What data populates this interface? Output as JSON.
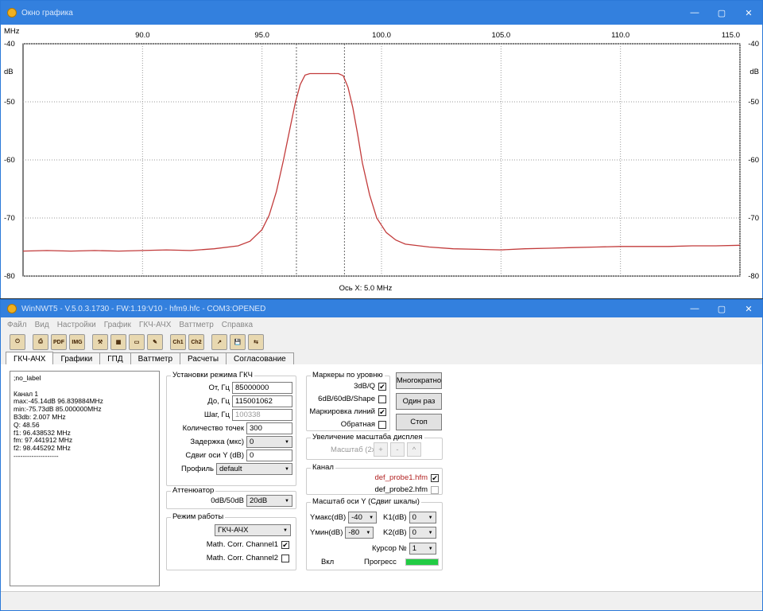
{
  "graph_window": {
    "title": "Окно графика",
    "controls": {
      "minimize": "—",
      "maximize": "▢",
      "close": "✕"
    },
    "x_unit": "MHz",
    "y_unit": "dB",
    "x_axis_label": "Ось X: 5.0 MHz"
  },
  "chart_data": {
    "type": "line",
    "xlim": [
      85.0,
      115.0
    ],
    "ylim": [
      -80,
      -40
    ],
    "x_ticks": [
      "90.0",
      "95.0",
      "100.0",
      "105.0",
      "110.0",
      "115.0"
    ],
    "x_tick_values": [
      90,
      95,
      100,
      105,
      110,
      115
    ],
    "y_ticks": [
      "-40",
      "-50",
      "-60",
      "-70",
      "-80"
    ],
    "y_tick_values": [
      -40,
      -50,
      -60,
      -70,
      -80
    ],
    "grid": true,
    "marker_lines_x": [
      96.44,
      98.45
    ],
    "color": "#c23b3b",
    "series": [
      {
        "x": [
          85.0,
          86.0,
          87.0,
          88.0,
          89.0,
          90.0,
          91.0,
          92.0,
          93.0,
          94.0,
          94.5,
          95.0,
          95.3,
          95.6,
          95.9,
          96.2,
          96.4,
          96.6,
          96.8,
          97.0,
          97.2,
          97.4,
          97.6,
          97.8,
          98.0,
          98.2,
          98.4,
          98.6,
          98.8,
          99.0,
          99.2,
          99.5,
          99.8,
          100.2,
          100.6,
          101.0,
          102.0,
          103.0,
          104.0,
          105.0,
          106.0,
          107.0,
          108.0,
          109.0,
          110.0,
          111.0,
          112.0,
          113.0,
          114.0,
          115.0
        ],
        "y": [
          -75.7,
          -75.6,
          -75.7,
          -75.6,
          -75.7,
          -75.6,
          -75.5,
          -75.6,
          -75.3,
          -74.8,
          -74.0,
          -72.0,
          -69.5,
          -65.5,
          -60.0,
          -54.0,
          -50.0,
          -47.0,
          -45.4,
          -45.14,
          -45.14,
          -45.14,
          -45.14,
          -45.14,
          -45.14,
          -45.14,
          -45.5,
          -47.5,
          -51.0,
          -55.5,
          -60.5,
          -66.0,
          -70.0,
          -72.5,
          -73.8,
          -74.5,
          -75.0,
          -75.3,
          -75.4,
          -75.5,
          -75.3,
          -75.2,
          -75.1,
          -75.0,
          -74.9,
          -74.9,
          -74.9,
          -74.8,
          -74.8,
          -74.7
        ]
      }
    ]
  },
  "main_window": {
    "title": "WinNWT5 - V.5.0.3.1730 - FW:1.19:V10 - hfm9.hfc - COM3:OPENED",
    "menu": [
      "Файл",
      "Вид",
      "Настройки",
      "График",
      "ГКЧ-АЧХ",
      "Ваттметр",
      "Справка"
    ],
    "toolbar": [
      {
        "name": "power-icon",
        "glyph": "⏻"
      },
      {
        "name": "print-icon",
        "glyph": "⎙"
      },
      {
        "name": "export-pdf-icon",
        "glyph": "PDF"
      },
      {
        "name": "export-image-icon",
        "glyph": "IMG"
      },
      {
        "name": "tools-icon",
        "glyph": "⚒"
      },
      {
        "name": "table-icon",
        "glyph": "▦"
      },
      {
        "name": "chart-icon",
        "glyph": "▭"
      },
      {
        "name": "probe-icon",
        "glyph": "✎"
      },
      {
        "name": "channel1-icon",
        "glyph": "Ch1"
      },
      {
        "name": "channel2-icon",
        "glyph": "Ch2"
      },
      {
        "name": "open-icon",
        "glyph": "↗"
      },
      {
        "name": "save-icon",
        "glyph": "💾"
      },
      {
        "name": "swap-icon",
        "glyph": "⇆"
      }
    ],
    "tabs": [
      "ГКЧ-АЧХ",
      "Графики",
      "ГПД",
      "Ваттметр",
      "Расчеты",
      "Согласование"
    ],
    "info_text": ";no_label\n\nКанал 1\nmax:-45.14dB 96.839884MHz\nmin:-75.73dB 85.000000MHz\nB3db: 2.007 MHz\nQ: 48.56\nf1: 96.438532 MHz\nfm: 97.441912 MHz\nf2: 98.445292 MHz\n--------------------",
    "gkch": {
      "title": "Установки режима ГКЧ",
      "from_label": "От, Гц",
      "from_value": "85000000",
      "to_label": "До, Гц",
      "to_value": "115001062",
      "step_label": "Шаг, Гц",
      "step_value": "100338",
      "points_label": "Количество точек",
      "points_value": "300",
      "delay_label": "Задержка (мкс)",
      "delay_value": "0",
      "yshift_label": "Сдвиг оси Y (dB)",
      "yshift_value": "0",
      "profile_label": "Профиль",
      "profile_value": "default"
    },
    "attenuator": {
      "title": "Аттенюатор",
      "label": "0dB/50dB",
      "value": "20dB"
    },
    "mode": {
      "title": "Режим работы",
      "value": "ГКЧ-АЧХ",
      "corr1": "Math. Corr. Channel1",
      "corr2": "Math. Corr. Channel2"
    },
    "markers": {
      "title": "Маркеры по уровню",
      "m1": "3dB/Q",
      "m2": "6dB/60dB/Shape",
      "m3": "Маркировка линий",
      "m4": "Обратная"
    },
    "buttons": {
      "multi": "Многократно",
      "once": "Один раз",
      "stop": "Стоп"
    },
    "zoom": {
      "title": "Увеличение масштаба дисплея",
      "label": "Масштаб (2x)",
      "plus": "+",
      "minus": "-",
      "up": "^"
    },
    "channel": {
      "title": "Канал",
      "probe1": "def_probe1.hfm",
      "probe2": "def_probe2.hfm"
    },
    "yscale": {
      "title": "Масштаб оси Y (Сдвиг шкалы)",
      "ymax_label": "Yмакс(dB)",
      "ymax_value": "-40",
      "ymin_label": "Yмин(dB)",
      "ymin_value": "-80",
      "k1_label": "K1(dB)",
      "k1_value": "0",
      "k2_label": "K2(dB)",
      "k2_value": "0",
      "cursor_label": "Курсор №",
      "cursor_value": "1",
      "on_label": "Вкл",
      "progress_label": "Прогресс"
    },
    "progress": 1.0,
    "colors": {
      "progress": "#22cc44",
      "probe1_text": "#b22222"
    }
  }
}
